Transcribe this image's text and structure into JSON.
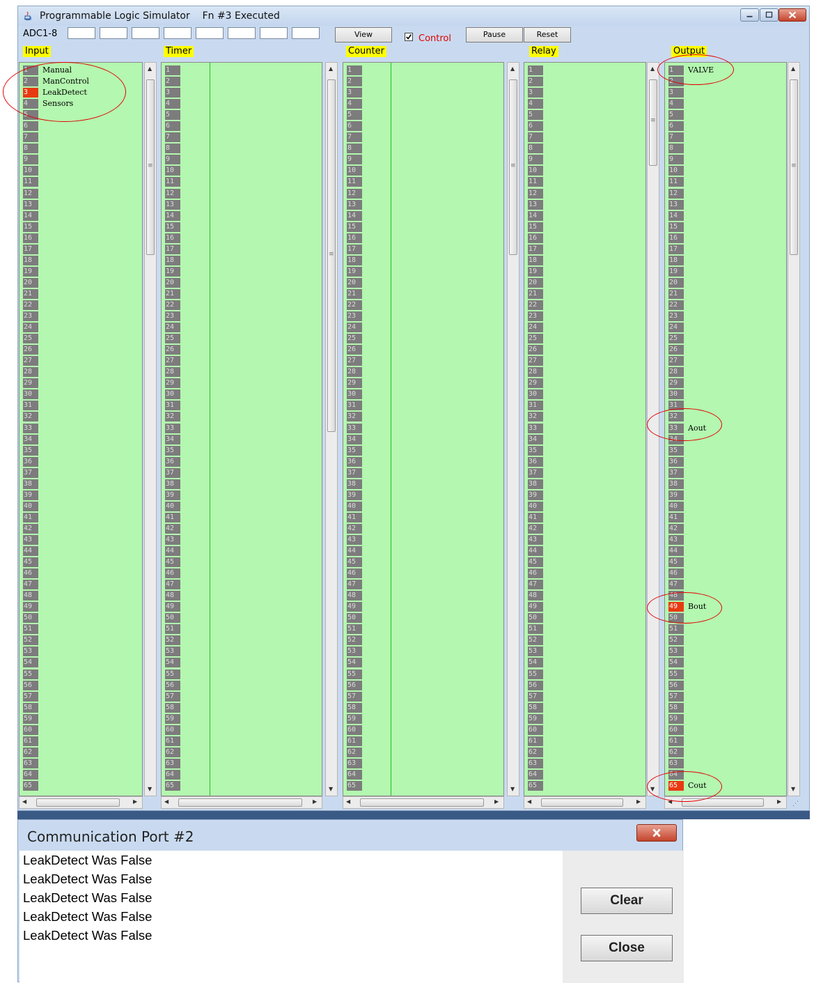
{
  "window": {
    "title": "Programmable Logic Simulator",
    "status": "Fn #3 Executed"
  },
  "toolbar": {
    "adc_label": "ADC1-8",
    "adc_values": [
      "",
      "",
      "",
      "",
      "",
      "",
      "",
      ""
    ],
    "view_label": "View",
    "control_label": "Control",
    "control_checked": true,
    "pause_label": "Pause",
    "reset_label": "Reset"
  },
  "columns": {
    "input": {
      "header": "Input",
      "labels": {
        "1": "Manual",
        "2": "ManControl",
        "3": "LeakDetect",
        "4": "Sensors"
      },
      "active": [
        3
      ]
    },
    "timer": {
      "header": "Timer"
    },
    "counter": {
      "header": "Counter"
    },
    "relay": {
      "header": "Relay"
    },
    "output": {
      "header": "Output",
      "labels": {
        "1": "VALVE",
        "33": "Aout",
        "49": "Bout",
        "65": "Cout"
      },
      "active": [
        49,
        65
      ]
    }
  },
  "row_count": 65,
  "dialog": {
    "title": "Communication Port #2",
    "log": [
      "LeakDetect Was False",
      "LeakDetect Was False",
      "LeakDetect Was False",
      "LeakDetect Was False",
      "LeakDetect Was False"
    ],
    "clear_label": "Clear",
    "close_label": "Close"
  },
  "colors": {
    "panel_bg": "#b4f7b0",
    "header_bg": "#ffff00",
    "active_cell": "#e83a12",
    "annotation": "#e40000"
  }
}
